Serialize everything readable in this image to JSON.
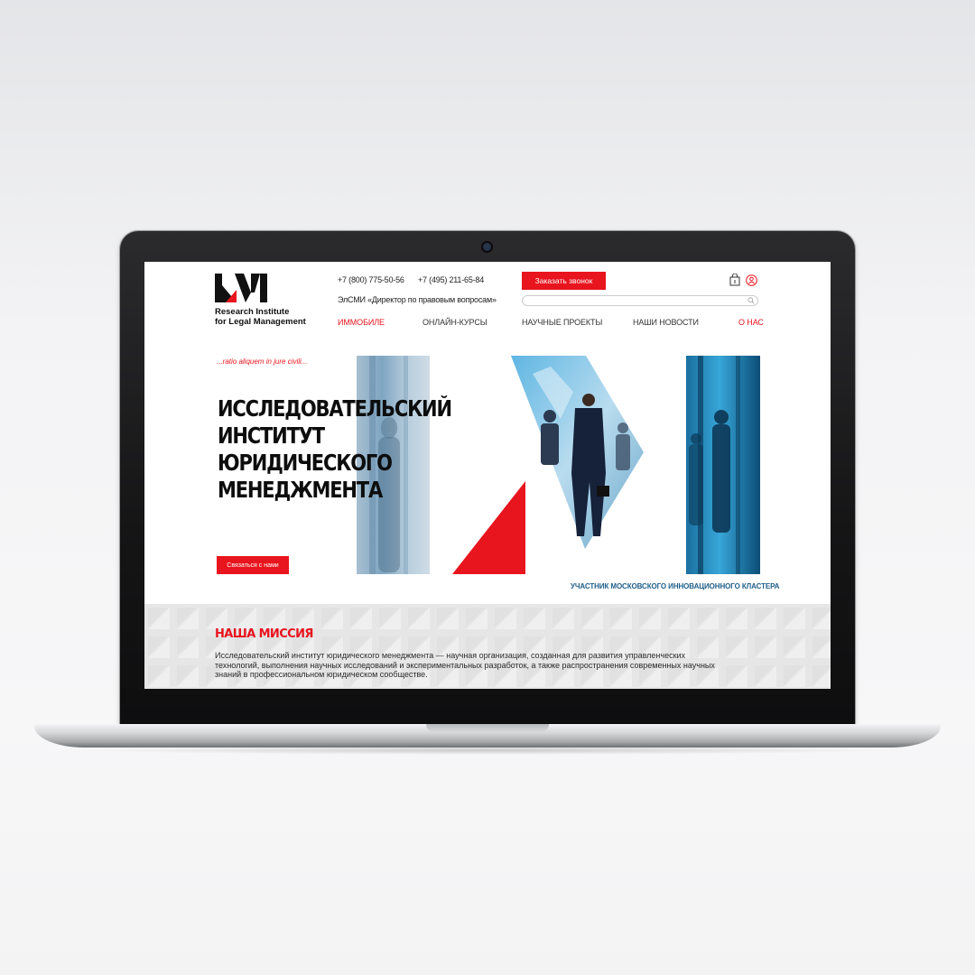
{
  "logo": {
    "mark": "LM",
    "line1": "Research Institute",
    "line2": "for Legal Management"
  },
  "contacts": {
    "phone1": "+7 (800) 775-50-56",
    "phone2": "+7 (495) 211-65-84",
    "media": "ЭлСМИ «Директор по правовым вопросам»"
  },
  "header": {
    "call_button": "Заказать звонок"
  },
  "nav": {
    "items": [
      {
        "label": "ИММОБИЛЕ",
        "active": true
      },
      {
        "label": "ОНЛАЙН-КУРСЫ",
        "active": false
      },
      {
        "label": "НАУЧНЫЕ ПРОЕКТЫ",
        "active": false
      },
      {
        "label": "НАШИ НОВОСТИ",
        "active": false
      },
      {
        "label": "О НАС",
        "active": true
      }
    ]
  },
  "hero": {
    "motto": "...ratio aliquem in jure civili...",
    "title_lines": [
      "ИССЛЕДОВАТЕЛЬСКИЙ",
      "ИНСТИТУТ",
      "ЮРИДИЧЕСКОГО",
      "МЕНЕДЖМЕНТА"
    ],
    "contact_button": "Связаться с нами",
    "cluster_caption": "УЧАСТНИК МОСКОВСКОГО ИННОВАЦИОННОГО КЛАСТЕРА"
  },
  "mission": {
    "title": "НАША МИССИЯ",
    "text_lines": [
      "Исследовательский институт юридического менеджмента — научная организация, созданная для развития управленческих",
      "технологий, выполнения научных исследований и экспериментальных разработок, а также распространения современных научных",
      "знаний в профессиональном юридическом сообществе."
    ]
  },
  "colors": {
    "accent": "#e8141e",
    "text": "#0d0d0d",
    "cluster_text": "#1f5f8b",
    "mission_bg": "#e6e6e6"
  },
  "icons": [
    "search-icon",
    "cart-icon",
    "user-icon"
  ]
}
